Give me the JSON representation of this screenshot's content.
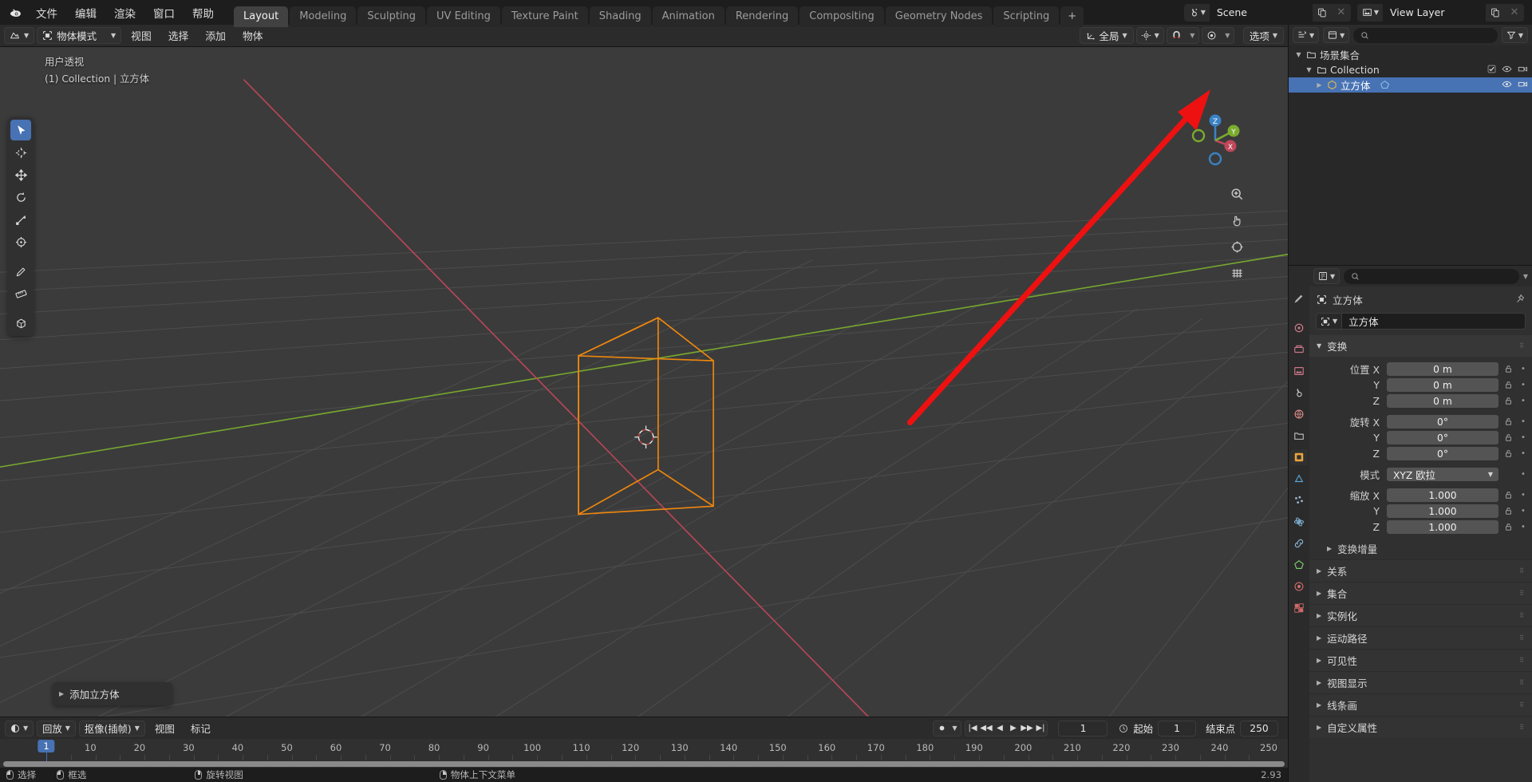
{
  "app": {
    "logo_icon": "blender-logo",
    "menus": [
      "文件",
      "编辑",
      "渲染",
      "窗口",
      "帮助"
    ],
    "workspace_tabs": [
      {
        "label": "Layout",
        "active": true
      },
      {
        "label": "Modeling",
        "active": false
      },
      {
        "label": "Sculpting",
        "active": false
      },
      {
        "label": "UV Editing",
        "active": false
      },
      {
        "label": "Texture Paint",
        "active": false
      },
      {
        "label": "Shading",
        "active": false
      },
      {
        "label": "Animation",
        "active": false
      },
      {
        "label": "Rendering",
        "active": false
      },
      {
        "label": "Compositing",
        "active": false
      },
      {
        "label": "Geometry Nodes",
        "active": false
      },
      {
        "label": "Scripting",
        "active": false
      }
    ],
    "add_tab_label": "+",
    "scene": {
      "icon": "scene-icon",
      "value": "Scene",
      "new_icon": "duplicate-icon",
      "unlink_icon": "x-icon"
    },
    "view_layer": {
      "icon": "view-layer-icon",
      "value": "View Layer",
      "new_icon": "duplicate-icon",
      "unlink_icon": "x-icon"
    }
  },
  "viewport_header": {
    "editor_type_icon": "editor-type-icon",
    "mode_icon": "object-mode-icon",
    "mode": "物体模式",
    "menus": [
      "视图",
      "选择",
      "添加",
      "物体"
    ],
    "transform_orientation": {
      "icon": "orientation-icon",
      "value": "全局"
    },
    "snap_icon": "magnet-icon",
    "proportional_icon": "proportional-edit-icon",
    "options_label": "选项",
    "visibility_icon": "visibility-icon",
    "gizmo_icon": "gizmo-icon",
    "overlays_icon": "overlays-icon",
    "xray_icon": "xray-icon",
    "shading_modes": [
      "wireframe",
      "solid",
      "material-preview",
      "rendered"
    ],
    "shading_active_index": 1
  },
  "toolbar_top": {
    "cursor_select_icon": "tweak-icon",
    "select_modes": [
      "select-new",
      "select-extend",
      "select-subtract",
      "select-invert",
      "select-intersect"
    ],
    "active_select_mode": 0
  },
  "viewport": {
    "perspective_label": "用户透视",
    "collection_label": "(1) Collection | 立方体",
    "tools": [
      {
        "name": "tweak-tool",
        "active": true
      },
      {
        "name": "cursor-tool",
        "active": false
      },
      {
        "name": "move-tool",
        "active": false
      },
      {
        "name": "rotate-tool",
        "active": false
      },
      {
        "name": "scale-tool",
        "active": false
      },
      {
        "name": "transform-tool",
        "active": false
      },
      {
        "name": "annotate-tool",
        "active": false
      },
      {
        "name": "measure-tool",
        "active": false
      },
      {
        "name": "add-cube-tool",
        "active": false
      }
    ],
    "gizmo_axes": {
      "x": "X",
      "y": "Y",
      "z": "Z"
    },
    "nav_buttons": [
      "zoom-icon",
      "pan-icon",
      "camera-icon",
      "ortho-perspective-icon"
    ],
    "operator_panel": {
      "label": "添加立方体"
    },
    "annotation": {
      "type": "arrow",
      "color": "#ee1111"
    }
  },
  "timeline": {
    "editor_icon": "timeline-editor-icon",
    "playback_menu": "回放",
    "keying_menu": "抠像(插帧)",
    "menus": [
      "视图",
      "标记"
    ],
    "keying_set_icon": "keying-set-icon",
    "transport": [
      "jump-start",
      "prev-keyframe",
      "play-reverse",
      "play",
      "next-keyframe",
      "jump-end"
    ],
    "current_frame": "1",
    "start_icon": "clock-icon",
    "start_label": "起始",
    "start_value": "1",
    "end_label": "结束点",
    "end_value": "250",
    "ruler_ticks": [
      "1",
      "10",
      "20",
      "30",
      "40",
      "50",
      "60",
      "70",
      "80",
      "90",
      "100",
      "110",
      "120",
      "130",
      "140",
      "150",
      "160",
      "170",
      "180",
      "190",
      "200",
      "210",
      "220",
      "230",
      "240",
      "250"
    ],
    "playhead_frame": "1"
  },
  "statusbar": {
    "items": [
      {
        "icon": "mouse-left-icon",
        "label": "选择"
      },
      {
        "icon": "mouse-left-drag-icon",
        "label": "框选"
      },
      {
        "icon": "mouse-middle-icon",
        "label": "旋转视图"
      },
      {
        "icon": "mouse-right-icon",
        "label": "物体上下文菜单"
      }
    ],
    "version": "2.93"
  },
  "outliner": {
    "display_mode_icon": "outliner-display-icon",
    "filter_icon": "filter-icon",
    "search_placeholder": "",
    "search_icon": "search-icon",
    "rows": [
      {
        "indent": 0,
        "disclosure": "down",
        "icon": "scene-collection-icon",
        "label": "场景集合",
        "selected": false,
        "toggles": []
      },
      {
        "indent": 1,
        "disclosure": "down",
        "icon": "collection-icon",
        "label": "Collection",
        "selected": false,
        "toggles": [
          "checkbox",
          "eye",
          "camera"
        ]
      },
      {
        "indent": 2,
        "disclosure": "right",
        "icon": "mesh-object-icon",
        "label": "立方体",
        "selected": true,
        "toggles": [
          "eye",
          "camera"
        ]
      }
    ]
  },
  "properties": {
    "tabs": [
      {
        "name": "tool-tab",
        "active": false
      },
      {
        "name": "render-tab",
        "active": false
      },
      {
        "name": "output-tab",
        "active": false
      },
      {
        "name": "view-layer-tab",
        "active": false
      },
      {
        "name": "scene-tab",
        "active": false
      },
      {
        "name": "world-tab",
        "active": false
      },
      {
        "name": "collection-tab",
        "active": false
      },
      {
        "name": "object-tab",
        "active": true
      },
      {
        "name": "modifier-tab",
        "active": false
      },
      {
        "name": "particles-tab",
        "active": false
      },
      {
        "name": "physics-tab",
        "active": false
      },
      {
        "name": "constraints-tab",
        "active": false
      },
      {
        "name": "data-tab",
        "active": false
      },
      {
        "name": "material-tab",
        "active": false
      },
      {
        "name": "texture-tab",
        "active": false
      }
    ],
    "editor_icon": "properties-editor-icon",
    "search_placeholder": "",
    "breadcrumb": {
      "icon": "object-icon",
      "label": "立方体",
      "pin_icon": "pin-icon"
    },
    "name_field": {
      "icon": "object-icon",
      "value": "立方体"
    },
    "transform_panel": {
      "title": "变换",
      "location_label": "位置",
      "rotation_label": "旋转",
      "scale_label": "缩放",
      "mode_label": "模式",
      "mode_value": "XYZ 欧拉",
      "axes": [
        "X",
        "Y",
        "Z"
      ],
      "location": [
        "0 m",
        "0 m",
        "0 m"
      ],
      "rotation": [
        "0°",
        "0°",
        "0°"
      ],
      "scale": [
        "1.000",
        "1.000",
        "1.000"
      ],
      "delta_transform": "变换增量"
    },
    "closed_panels": [
      "关系",
      "集合",
      "实例化",
      "运动路径",
      "可见性",
      "视图显示",
      "线条画",
      "自定义属性"
    ]
  },
  "colors": {
    "accent": "#4772b3",
    "selected_object": "#f5a623",
    "annotation_red": "#ee1111",
    "axis_x": "#c0475a",
    "axis_y": "#7aac2e"
  }
}
